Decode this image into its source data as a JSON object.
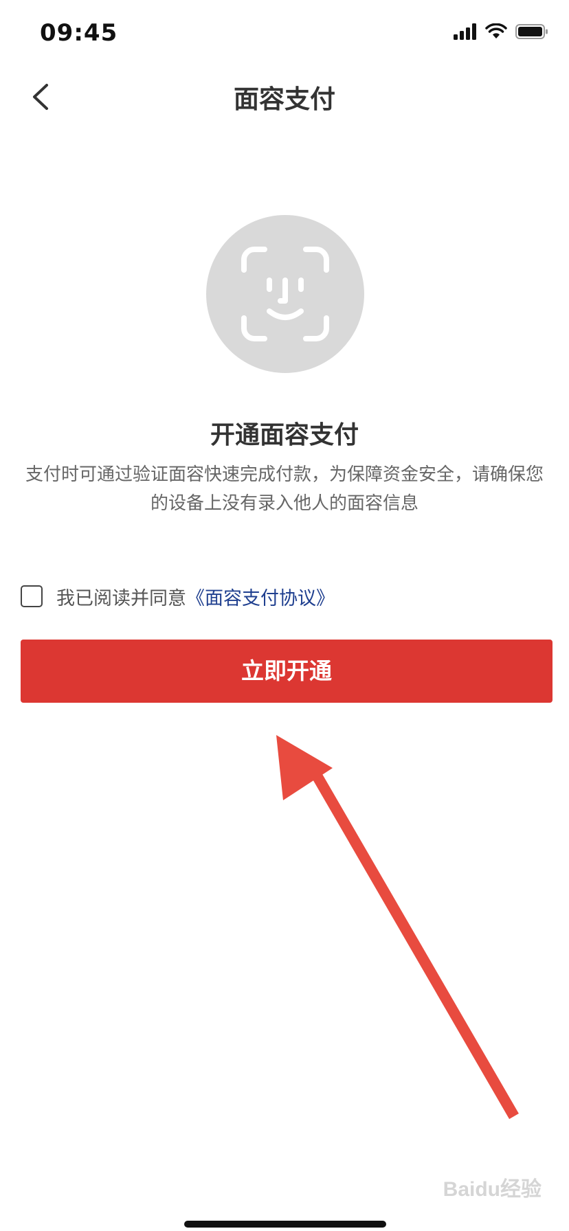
{
  "status_bar": {
    "time": "09:45"
  },
  "nav": {
    "title": "面容支付"
  },
  "main": {
    "headline": "开通面容支付",
    "description": "支付时可通过验证面容快速完成付款，为保障资金安全，请确保您的设备上没有录入他人的面容信息"
  },
  "agreement": {
    "checked": false,
    "text": "我已阅读并同意",
    "link_label": "《面容支付协议》"
  },
  "primary_button": {
    "label": "立即开通"
  },
  "watermark": {
    "text": "Baidu经验"
  },
  "colors": {
    "primary": "#dc3732",
    "link": "#1f3f8f",
    "face_circle": "#d9d9d9",
    "annotation_arrow": "#e84b3f"
  }
}
